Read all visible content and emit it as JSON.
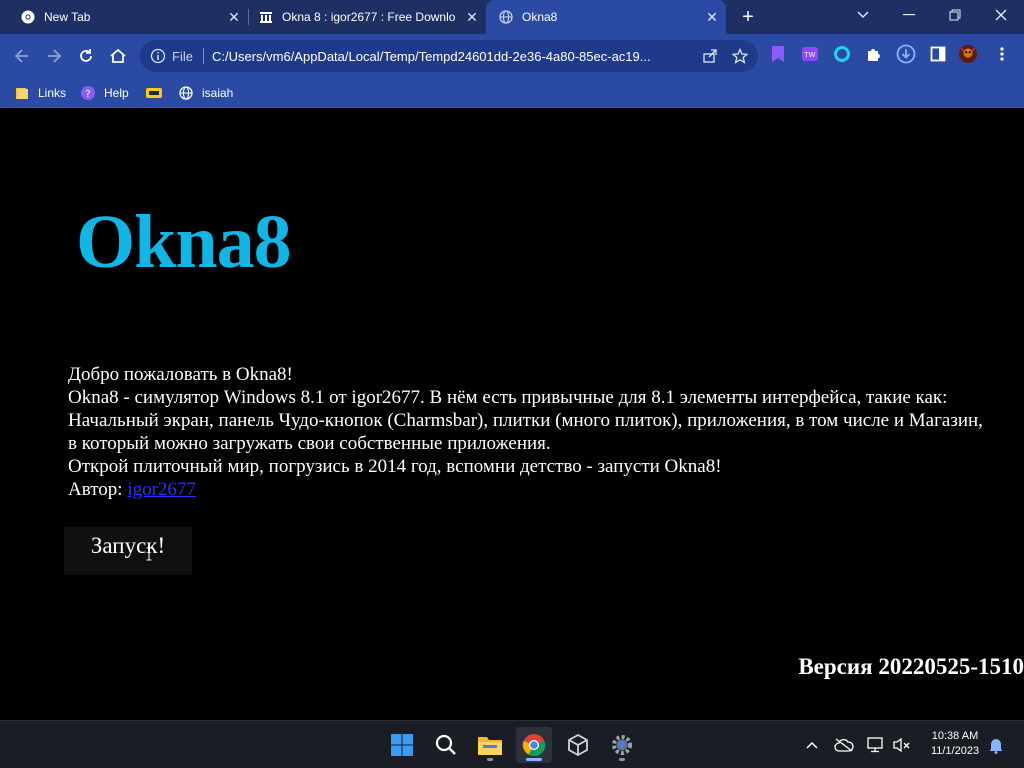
{
  "browser": {
    "tabs": [
      {
        "title": "New Tab",
        "favicon": "chrome-icon",
        "active": false
      },
      {
        "title": "Okna 8 : igor2677 : Free Downlo",
        "favicon": "archive-icon",
        "active": false
      },
      {
        "title": "Okna8",
        "favicon": "globe-icon",
        "active": true
      }
    ],
    "address": {
      "scheme_label": "File",
      "url": "C:/Users/vm6/AppData/Local/Temp/Tempd24601dd-2e36-4a80-85ec-ac19..."
    },
    "bookmarks": [
      {
        "label": "Links",
        "icon": "folder-icon"
      },
      {
        "label": "Help",
        "icon": "help-icon"
      },
      {
        "label": "",
        "icon": "yellow-bookmark-icon"
      },
      {
        "label": "isaiah",
        "icon": "globe-icon"
      }
    ],
    "colors": {
      "tabbar": "#1e2f63",
      "toolbar": "#2b4aa3"
    }
  },
  "page": {
    "logo": "Okna8",
    "welcome": "Добро пожаловать в Okna8!",
    "description": "Okna8 - симулятор Windows 8.1 от igor2677. В нём есть привычные для 8.1 элементы интерфейса, такие как: Начальный экран, панель Чудо-кнопок (Charmsbar), плитки (много плиток), приложения, в том числе и Магазин, в который можно загружать свои собственные приложения.",
    "tagline": "Открой плиточный мир, погрузись в 2014 год, вспомни детство - запусти Okna8!",
    "author_label": "Автор:",
    "author_link": "igor2677",
    "launch_button": "Запуск!",
    "version": "Версия 20220525-1510",
    "colors": {
      "logo": "#10b7e6",
      "background": "#000000",
      "link": "#2d2dff"
    }
  },
  "taskbar": {
    "apps": [
      "start-icon",
      "search-icon",
      "file-explorer-icon",
      "chrome-icon",
      "virtualbox-icon",
      "settings-icon"
    ],
    "active_app": "chrome-icon",
    "time": "10:38 AM",
    "date": "11/1/2023"
  }
}
